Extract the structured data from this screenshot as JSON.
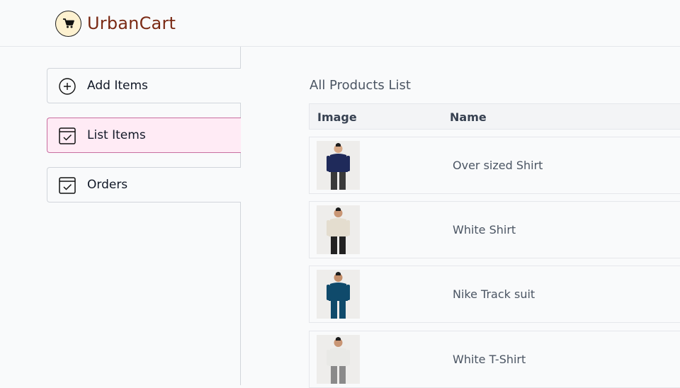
{
  "brand": {
    "name": "UrbanCart",
    "icon": "cart-icon"
  },
  "sidebar": {
    "items": [
      {
        "label": "Add Items",
        "icon": "plus-circle-icon",
        "active": false
      },
      {
        "label": "List Items",
        "icon": "checkbox-icon",
        "active": true
      },
      {
        "label": "Orders",
        "icon": "checkbox-icon",
        "active": false
      }
    ]
  },
  "main": {
    "title": "All Products List",
    "columns": [
      "Image",
      "Name"
    ],
    "products": [
      {
        "name": "Over sized Shirt",
        "colors": {
          "top": "#1f2a5a",
          "bottom": "#3a3a3a",
          "skin": "#d7a987"
        }
      },
      {
        "name": "White Shirt",
        "colors": {
          "top": "#e4ddcf",
          "bottom": "#222222",
          "skin": "#c99675"
        }
      },
      {
        "name": "Nike Track suit",
        "colors": {
          "top": "#0f4a6b",
          "bottom": "#0f4a6b",
          "skin": "#c38e6a"
        }
      },
      {
        "name": "White T-Shirt",
        "colors": {
          "top": "#e9e9e6",
          "bottom": "#8a8a8a",
          "skin": "#c99675"
        }
      }
    ]
  },
  "colors": {
    "brand_text": "#7a2a14",
    "active_bg": "#ffebf5",
    "active_border": "#c86ea0"
  }
}
